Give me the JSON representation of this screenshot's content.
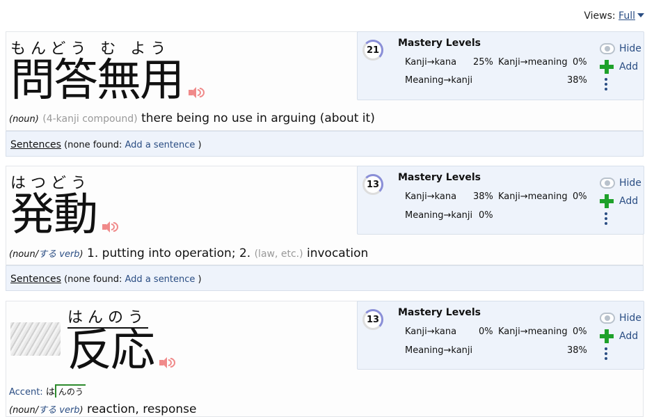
{
  "views": {
    "label": "Views:",
    "value": "Full"
  },
  "entries": [
    {
      "furigana": "もんどう む よう",
      "kanji": "問答無用",
      "pos": "(noun)",
      "pos_extra": "(4-kanji compound)",
      "gloss": "there being no use in arguing (about it)",
      "mastery": {
        "level": "21",
        "title": "Mastery Levels",
        "kanji_kana_label": "Kanji→kana",
        "kanji_kana": "25%",
        "kanji_meaning_label": "Kanji→meaning",
        "kanji_meaning": "0%",
        "meaning_kanji_label": "Meaning→kanji",
        "meaning_kanji": "38%"
      },
      "actions": {
        "hide": "Hide",
        "add": "Add"
      },
      "sentences": {
        "label": "Sentences",
        "none": "(none found:",
        "add": "Add a sentence",
        "close": ")"
      }
    },
    {
      "furigana": "はつどう",
      "kanji": "発動",
      "pos_a": "(noun/",
      "pos_b": "する verb",
      "pos_c": ")",
      "gloss_1": "1. putting into operation; 2.",
      "gloss_muted": "(law, etc.)",
      "gloss_2": "invocation",
      "mastery": {
        "level": "13",
        "title": "Mastery Levels",
        "kanji_kana_label": "Kanji→kana",
        "kanji_kana": "38%",
        "kanji_meaning_label": "Kanji→meaning",
        "kanji_meaning": "0%",
        "meaning_kanji_label": "Meaning→kanji",
        "meaning_kanji": "0%"
      },
      "actions": {
        "hide": "Hide",
        "add": "Add"
      },
      "sentences": {
        "label": "Sentences",
        "none": "(none found:",
        "add": "Add a sentence",
        "close": ")"
      }
    },
    {
      "furigana": "はんのう",
      "kanji": "反応",
      "accent_label": "Accent:",
      "accent_head": "は",
      "accent_rest": "んのう",
      "pos_a": "(noun/",
      "pos_b": "する verb",
      "pos_c": ")",
      "gloss": "reaction, response",
      "mastery": {
        "level": "13",
        "title": "Mastery Levels",
        "kanji_kana_label": "Kanji→kana",
        "kanji_kana": "0%",
        "kanji_meaning_label": "Kanji→meaning",
        "kanji_meaning": "0%",
        "meaning_kanji_label": "Meaning→kanji",
        "meaning_kanji": "38%"
      },
      "actions": {
        "hide": "Hide",
        "add": "Add"
      }
    }
  ]
}
